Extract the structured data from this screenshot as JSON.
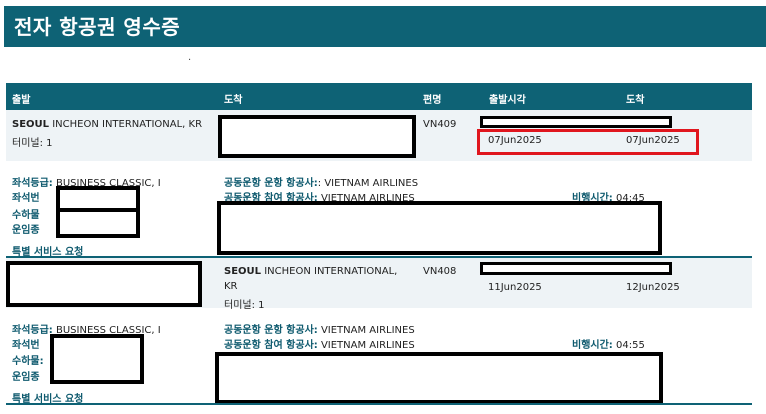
{
  "page": {
    "title": "전자 항공권 영수증",
    "stray_mark": "."
  },
  "table_header": {
    "departure": "출발",
    "arrival": "도착",
    "flight": "편명",
    "departure_time": "출발시각",
    "arrival_time": "도착"
  },
  "segments": [
    {
      "origin_city": "SEOUL",
      "origin_airport": "INCHEON INTERNATIONAL, KR",
      "terminal_label": "터미널:",
      "terminal_value": "1",
      "flight": "VN409",
      "departure_date": "07Jun2025",
      "arrival_date": "07Jun2025",
      "class_label": "좌석등급:",
      "class_value": "BUSINESS CLASSIC, I",
      "seat_label": "좌석번",
      "baggage_label": "수하물",
      "fare_label": "운임종",
      "special_label": "특별 서비스 요청",
      "operating_label": "공동운항 운항 항공사:",
      "operating_value": ": VIETNAM AIRLINES",
      "marketing_label": "공동운항 참여 항공사:",
      "marketing_value": "VIETNAM AIRLINES",
      "duration_label": "비행시간:",
      "duration_value": "04:45"
    },
    {
      "dest_city": "SEOUL",
      "dest_airport_line1": "INCHEON INTERNATIONAL,",
      "dest_airport_line2": "KR",
      "terminal_label": "터미널:",
      "terminal_value": "1",
      "flight": "VN408",
      "departure_date": "11Jun2025",
      "arrival_date": "12Jun2025",
      "class_label": "좌석등급:",
      "class_value": "BUSINESS CLASSIC, I",
      "seat_label": "좌석번",
      "baggage_label": "수하물:",
      "fare_label": "운임종",
      "special_label": "특별 서비스 요청",
      "operating_label": "공동운항 운항 항공사:",
      "operating_value": "VIETNAM AIRLINES",
      "marketing_label": "공동운항 참여 항공사:",
      "marketing_value": "VIETNAM AIRLINES",
      "duration_label": "비행시간:",
      "duration_value": "04:55"
    }
  ]
}
